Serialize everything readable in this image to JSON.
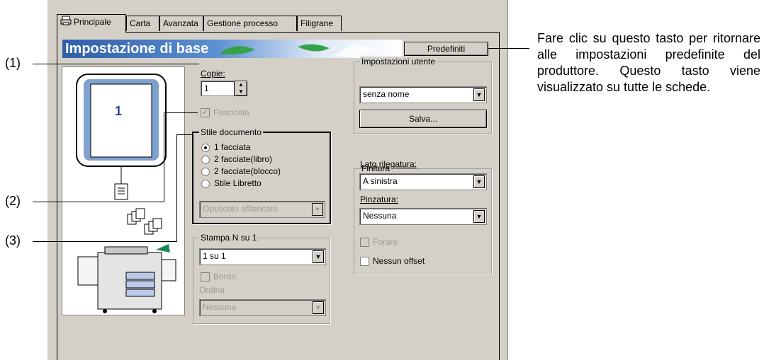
{
  "tabs": [
    {
      "label": "Principale",
      "active": true
    },
    {
      "label": "Carta",
      "active": false
    },
    {
      "label": "Avanzata",
      "active": false
    },
    {
      "label": "Gestione processo",
      "active": false
    },
    {
      "label": "Filigrane",
      "active": false
    }
  ],
  "banner": {
    "title": "Impostazione di base"
  },
  "buttons": {
    "defaults": "Predefiniti",
    "save": "Salva..."
  },
  "preview": {
    "page_number": "1"
  },
  "copies": {
    "label": "Copie:",
    "value": "1"
  },
  "collate": {
    "label": "Fascicola",
    "checked": true,
    "enabled": false
  },
  "document_style": {
    "title": "Stile documento",
    "options": [
      "1 facciata",
      "2 facciate(libro)",
      "2 facciate(blocco)",
      "Stile Libretto"
    ],
    "selected_index": 0,
    "booklet_select": "Opuscolo affiancato"
  },
  "n_up": {
    "title": "Stampa N su 1",
    "value": "1 su 1",
    "border_label": "Bordo",
    "order_label": "Ordina",
    "order_value": "Nessuna"
  },
  "user_settings": {
    "title": "Impostazioni utente",
    "value": "senza nome"
  },
  "finishing": {
    "title": "Finitura",
    "binding_label": "Lato rilegatura:",
    "binding_value": "A sinistra",
    "staple_label": "Pinzatura:",
    "staple_value": "Nessuna",
    "punch_label": "Forare",
    "no_offset_label": "Nessun offset"
  },
  "callouts": {
    "c1": "(1)",
    "c2": "(2)",
    "c3": "(3)"
  },
  "description": "Fare clic su questo tasto per ritornare alle impostazioni predefinite del produttore. Questo tasto viene visualizzato su tutte le schede.",
  "icons": {
    "tab_icon": "printer-icon",
    "dropdown": "chevron-down-icon"
  }
}
